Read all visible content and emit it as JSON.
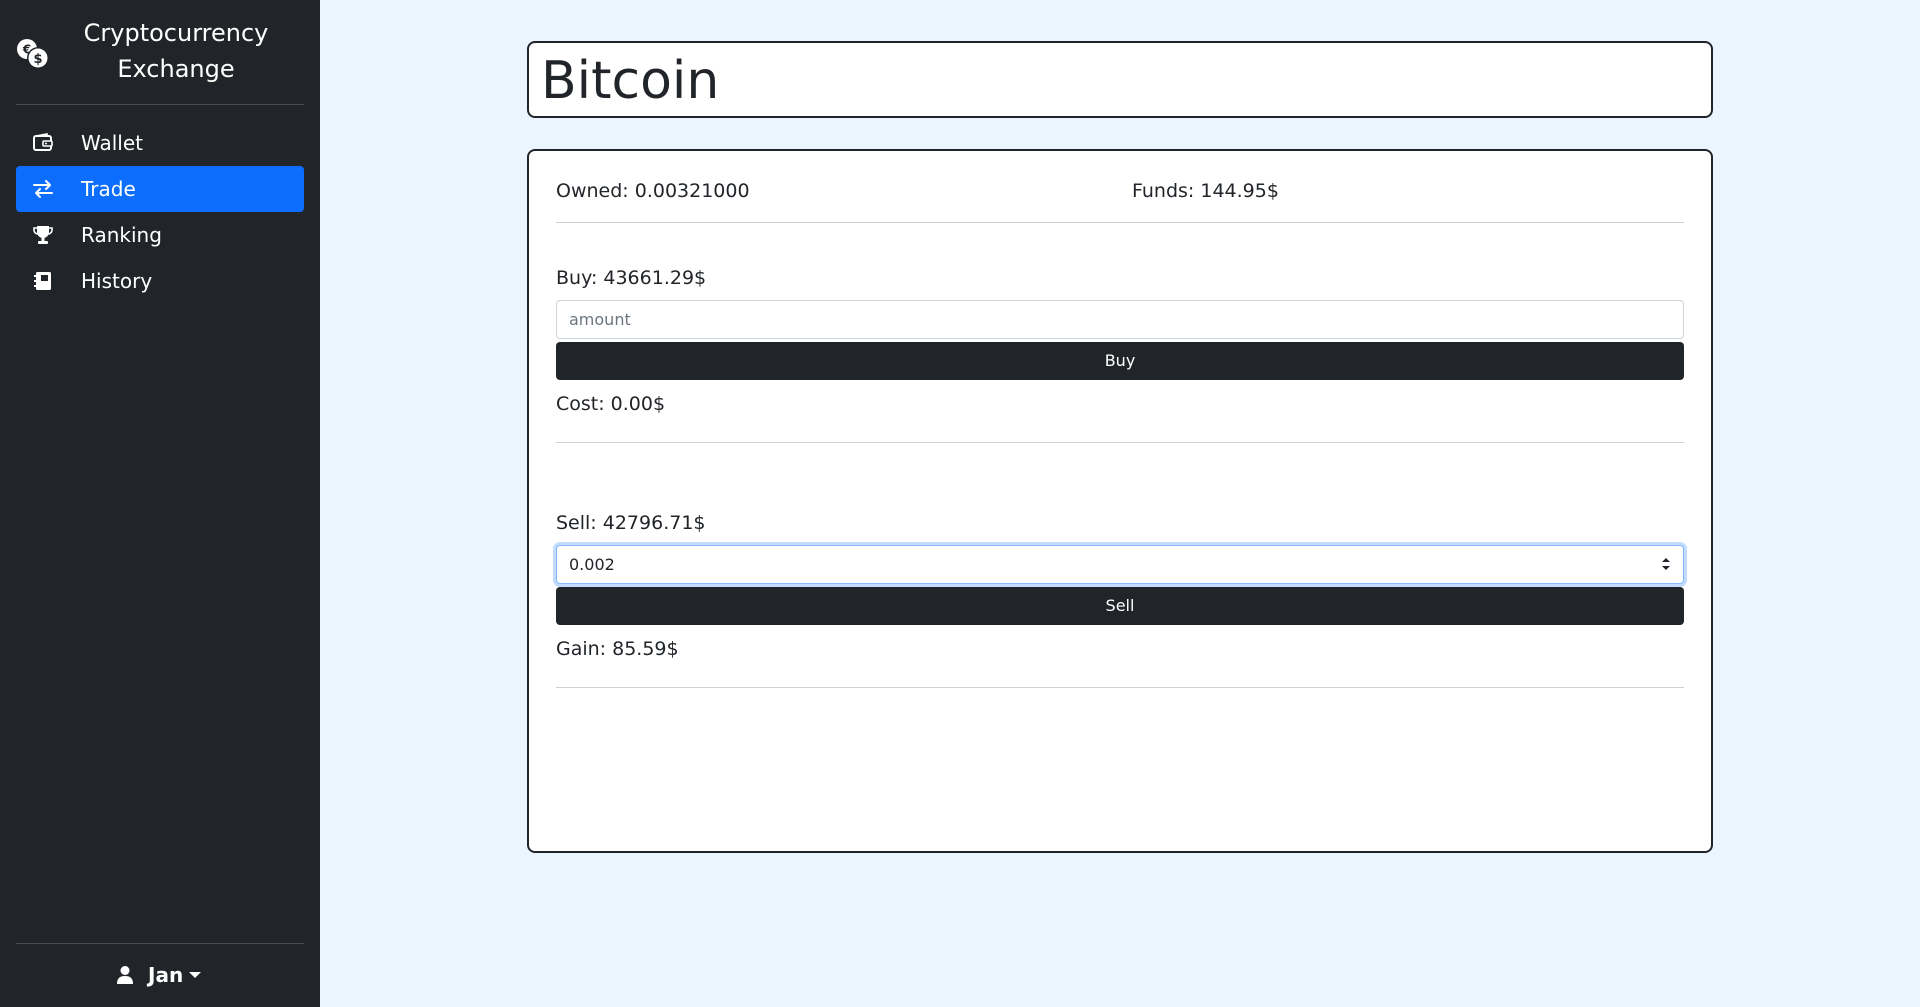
{
  "app": {
    "title": "Cryptocurrency Exchange",
    "logo_icon": "coins-icon"
  },
  "sidebar": {
    "items": [
      {
        "label": "Wallet",
        "icon": "wallet-icon",
        "active": false
      },
      {
        "label": "Trade",
        "icon": "arrows-exchange-icon",
        "active": true
      },
      {
        "label": "Ranking",
        "icon": "trophy-icon",
        "active": false
      },
      {
        "label": "History",
        "icon": "journal-icon",
        "active": false
      }
    ],
    "user": {
      "name": "Jan",
      "icon": "person-icon"
    }
  },
  "main": {
    "coin_name": "Bitcoin",
    "owned": "Owned: 0.00321000",
    "funds": "Funds: 144.95$",
    "buy": {
      "price_label": "Buy: 43661.29$",
      "input_placeholder": "amount",
      "input_value": "",
      "button_label": "Buy",
      "result": "Cost: 0.00$"
    },
    "sell": {
      "price_label": "Sell: 42796.71$",
      "input_value": "0.002",
      "button_label": "Sell",
      "result": "Gain: 85.59$"
    }
  },
  "colors": {
    "sidebar_bg": "#212529",
    "active_nav": "#0d6efd",
    "page_bg": "#ebf5ff",
    "button_bg": "#212529"
  }
}
